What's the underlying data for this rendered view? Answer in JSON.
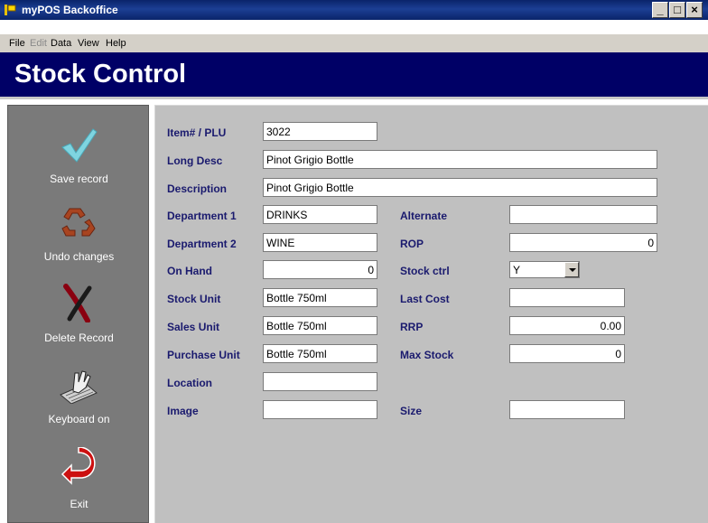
{
  "window": {
    "title": "myPOS Backoffice",
    "controls": {
      "minimize": "_",
      "maximize": "□",
      "close": "×"
    }
  },
  "menu": {
    "items": [
      "File",
      "Edit",
      "Data",
      "View",
      "Help"
    ],
    "disabled": [
      "Edit"
    ]
  },
  "header": {
    "title": "Stock Control",
    "background": "#000066"
  },
  "sidebar": {
    "buttons": [
      {
        "label": "Save record",
        "icon": "checkmark-icon"
      },
      {
        "label": "Undo changes",
        "icon": "recycle-icon"
      },
      {
        "label": "Delete Record",
        "icon": "x-mark-icon"
      },
      {
        "label": "Keyboard on",
        "icon": "keyboard-hand-icon"
      },
      {
        "label": "Exit",
        "icon": "exit-arrow-icon"
      }
    ]
  },
  "form": {
    "item_plu": {
      "label": "Item# / PLU",
      "value": "3022"
    },
    "long_desc": {
      "label": "Long Desc",
      "value": "Pinot Grigio Bottle"
    },
    "description": {
      "label": "Description",
      "value": "Pinot Grigio Bottle"
    },
    "department1": {
      "label": "Department 1",
      "value": "DRINKS"
    },
    "department2": {
      "label": "Department 2",
      "value": "WINE"
    },
    "on_hand": {
      "label": "On Hand",
      "value": "0"
    },
    "stock_unit": {
      "label": "Stock Unit",
      "value": "Bottle 750ml"
    },
    "sales_unit": {
      "label": "Sales Unit",
      "value": "Bottle 750ml"
    },
    "purchase_unit": {
      "label": "Purchase Unit",
      "value": "Bottle 750ml"
    },
    "location": {
      "label": "Location",
      "value": ""
    },
    "image": {
      "label": "Image",
      "value": ""
    },
    "alternate": {
      "label": "Alternate",
      "value": ""
    },
    "rop": {
      "label": "ROP",
      "value": "0"
    },
    "stock_ctrl": {
      "label": "Stock ctrl",
      "value": "Y"
    },
    "last_cost": {
      "label": "Last Cost",
      "value": ""
    },
    "rrp": {
      "label": "RRP",
      "value": "0.00"
    },
    "max_stock": {
      "label": "Max Stock",
      "value": "0"
    },
    "size": {
      "label": "Size",
      "value": ""
    }
  }
}
